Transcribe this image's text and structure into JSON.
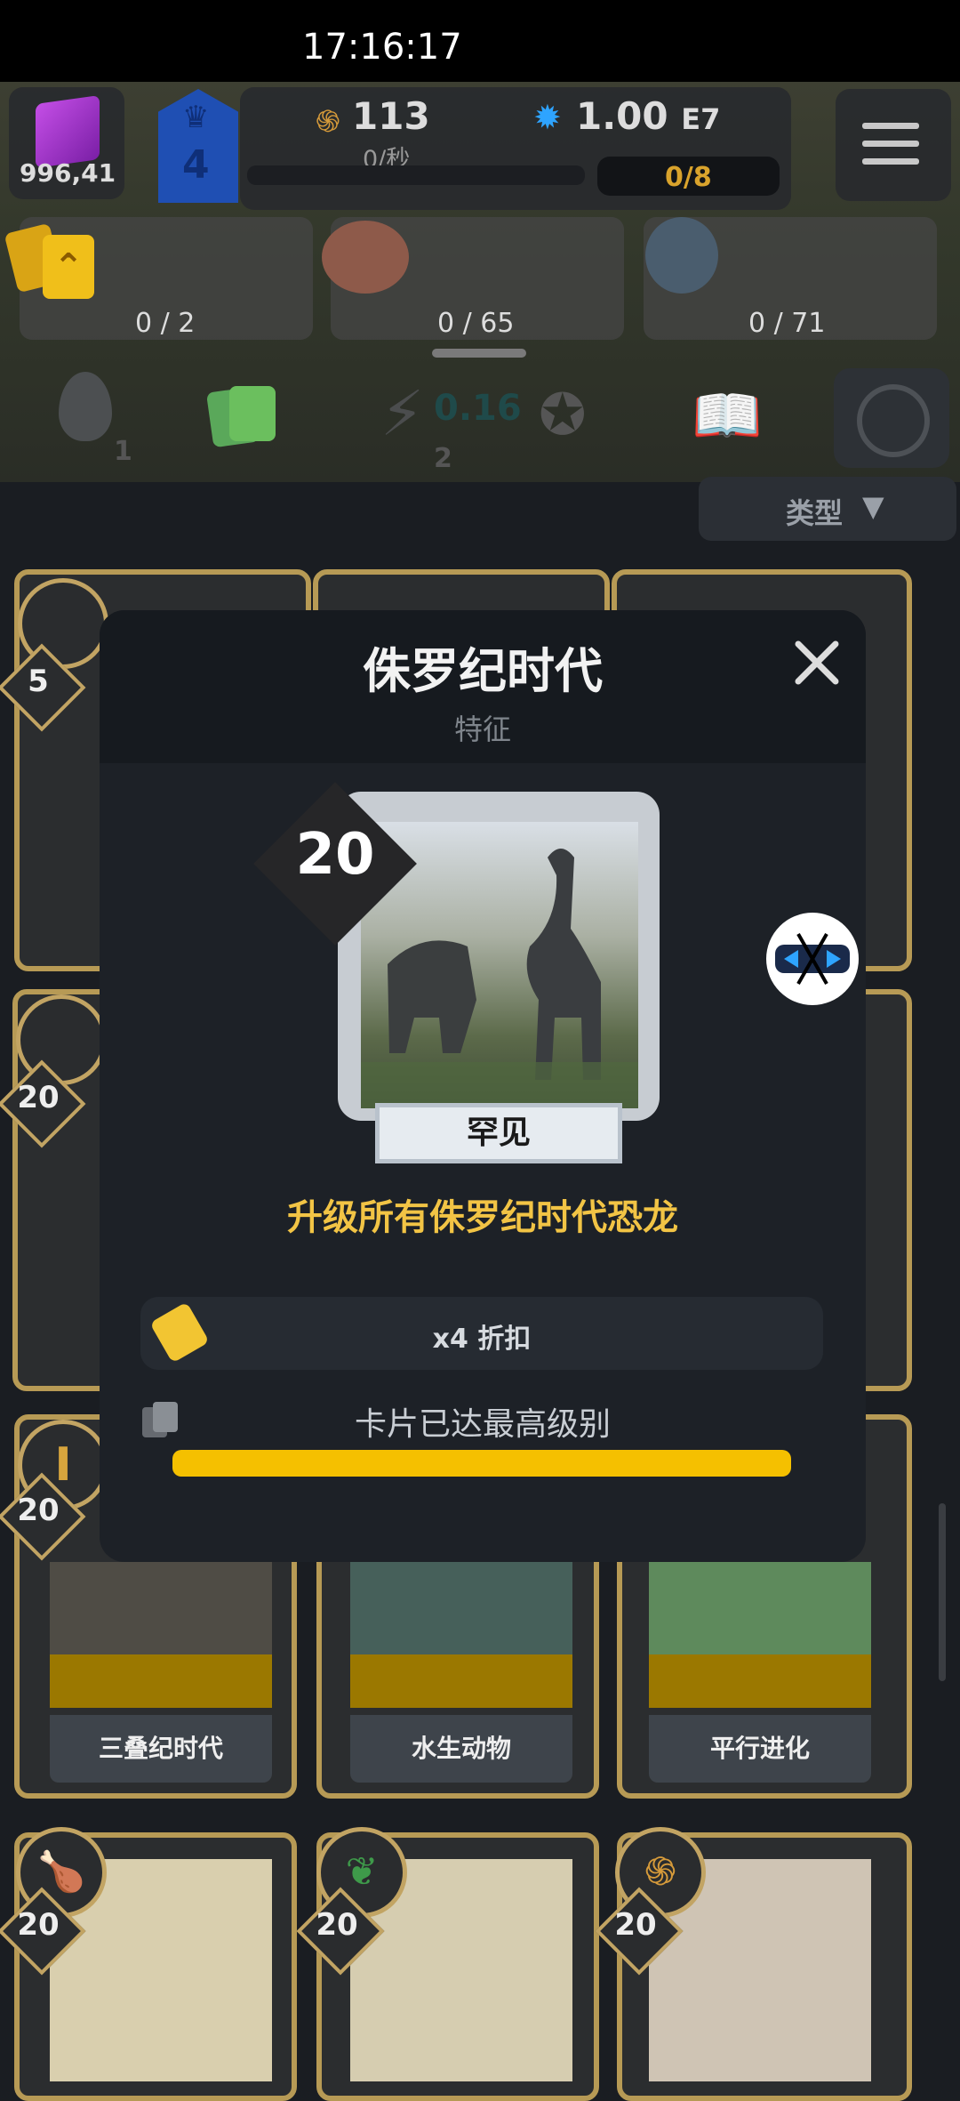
{
  "status_bar": {
    "time": "17:16:17"
  },
  "hud": {
    "gems": "996,41",
    "level": "4",
    "fossils": "113",
    "fossil_rate": "0/秒",
    "dna_value": "1.00",
    "dna_exp": "E7",
    "slots": "0/8",
    "icons": {
      "gem": "purple-cube-icon",
      "level": "crown-badge-icon",
      "fossil": "ammonite-icon",
      "dna": "dna-gear-icon",
      "menu": "hamburger-menu-icon"
    }
  },
  "collection_slots": [
    {
      "label": "0 / 2"
    },
    {
      "label": "0 / 65"
    },
    {
      "label": "0 / 71"
    }
  ],
  "tabs": [
    {
      "icon": "egg-icon",
      "count": "1"
    },
    {
      "icon": "cards-icon",
      "count": ""
    },
    {
      "icon": "lightning-icon",
      "count": "2",
      "extra": "0.16"
    },
    {
      "icon": "medal-icon",
      "count": ""
    },
    {
      "icon": "book-icon",
      "count": ""
    },
    {
      "icon": "portal-icon",
      "count": ""
    }
  ],
  "filter": {
    "label": "类型"
  },
  "background_cards": [
    {
      "level": "5",
      "name": ""
    },
    {
      "level": "20",
      "name": ""
    },
    {
      "level": "20",
      "name": "三叠纪时代"
    },
    {
      "level": "",
      "name": "水生动物"
    },
    {
      "level": "",
      "name": "平行进化"
    },
    {
      "level": "20",
      "name": ""
    },
    {
      "level": "20",
      "name": ""
    },
    {
      "level": "20",
      "name": ""
    }
  ],
  "modal": {
    "title": "侏罗纪时代",
    "subtitle": "特征",
    "card_level": "20",
    "rarity": "罕见",
    "description": "升级所有侏罗纪时代恐龙",
    "discount": "x4 折扣",
    "maxed_label": "卡片已达最高级别",
    "maxed_progress": 1.0
  },
  "colors": {
    "accent_yellow": "#f5c000",
    "gold_border": "#b79a55",
    "desc_yellow": "#f2c445"
  }
}
